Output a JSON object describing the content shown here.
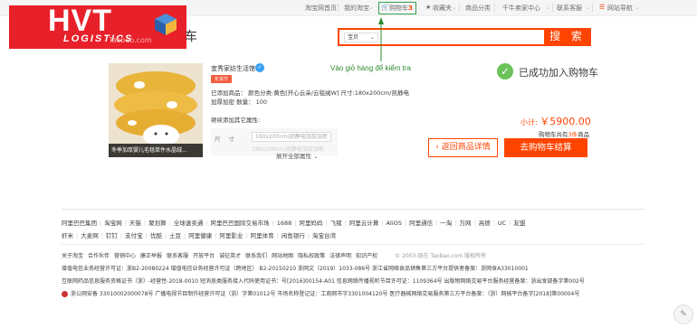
{
  "topnav": {
    "items": [
      "淘宝网首页",
      "我的淘宝",
      "购物车",
      "收藏夹",
      "商品分类",
      "千牛卖家中心",
      "联系客服",
      "网站导航"
    ],
    "cart_count": "3"
  },
  "logo": {
    "brand": "HVT",
    "sub": "LOGISTICS",
    "tail": "车",
    "faded": "Taobao.com"
  },
  "search": {
    "type": "宝贝",
    "button": "搜 索"
  },
  "annotation": {
    "text": "Vào giỏ hàng để kiểm tra"
  },
  "success": {
    "icon": "check-icon",
    "text": "已成功加入购物车"
  },
  "product": {
    "image_caption": "冬季加厚婴儿毛毯单件水晶绒...",
    "shop": "宜秀家纺生活馆",
    "tag": "年货节",
    "line1": "已添加商品：  颜色分类:黄色[开心云朵/云毯绒W] 尺寸:180x200cm/凯静电",
    "line2": "加厚加密  数量：  100",
    "continue_label": "继续添加其它属性:",
    "attr_key": "尺寸",
    "attr_value": "180x200cm/凯静电加厚加密",
    "attr_ghost": "180x200cm/凯静电加厚加密",
    "expand": "展开全部属性 ⌄"
  },
  "price": {
    "label": "小计:",
    "amount": "￥5900.00",
    "note_pre": "购物车共有",
    "note_num": "3件",
    "note_post": "商品"
  },
  "buttons": {
    "back": "‹ 返回商品详情",
    "checkout": "去购物车结算"
  },
  "footer": {
    "links1": [
      "阿里巴巴集团",
      "淘宝网",
      "天猫",
      "聚划算",
      "全球速卖通",
      "阿里巴巴国际交易市场",
      "1688",
      "阿里妈妈",
      "飞猪",
      "阿里云计算",
      "AliOS",
      "阿里通信",
      "一淘",
      "万网",
      "高德",
      "UC",
      "友盟"
    ],
    "links2": [
      "虾米",
      "大麦网",
      "钉钉",
      "支付宝",
      "优酷",
      "土豆",
      "阿里健康",
      "阿里影业",
      "阿里体育",
      "闲鱼银行",
      "淘宝台湾"
    ],
    "about": [
      "关于淘宝",
      "合作伙伴",
      "营销中心",
      "廉正举报",
      "联系客服",
      "开放平台",
      "诚征英才",
      "联系我们",
      "网站地图",
      "隐私权政策",
      "法律声明",
      "知识产权"
    ],
    "copyright": "© 2003-现在 Taobao.com 版权所有",
    "lic1": "增值电信业务经营许可证：浙B2-20080224    增值电信业务经营许可证（跨地区）  B2-20150210  浙网文（2019）1033-086号  浙江省网络食品销售第三方平台提供者备案：浙网食A33010001",
    "lic2": "互联网药品信息服务资格证书（浙）-经营性-2018-0010    短消息类服务接入代码使用证书：号[2016]00154-A01  信息网络传播视听节目许可证：1109364号  出版物网络交易平台服务经营备案：浙出发部备字第002号",
    "lic3": "浙公网安备 33010002000078号    广播电视节目制作经营许可证（浙）字第01012号  市场名称登记证：工商网市字3301004120号  医疗器械网络交易服务第三方平台备案：（浙）网械平台备字[2018]第00004号"
  },
  "corner": {
    "icon": "edit-icon",
    "glyph": "✎"
  },
  "colors": {
    "accent": "#ff4400",
    "success": "#6ac259",
    "annotation": "#2d8a2d",
    "logo_red": "#e8202a"
  }
}
